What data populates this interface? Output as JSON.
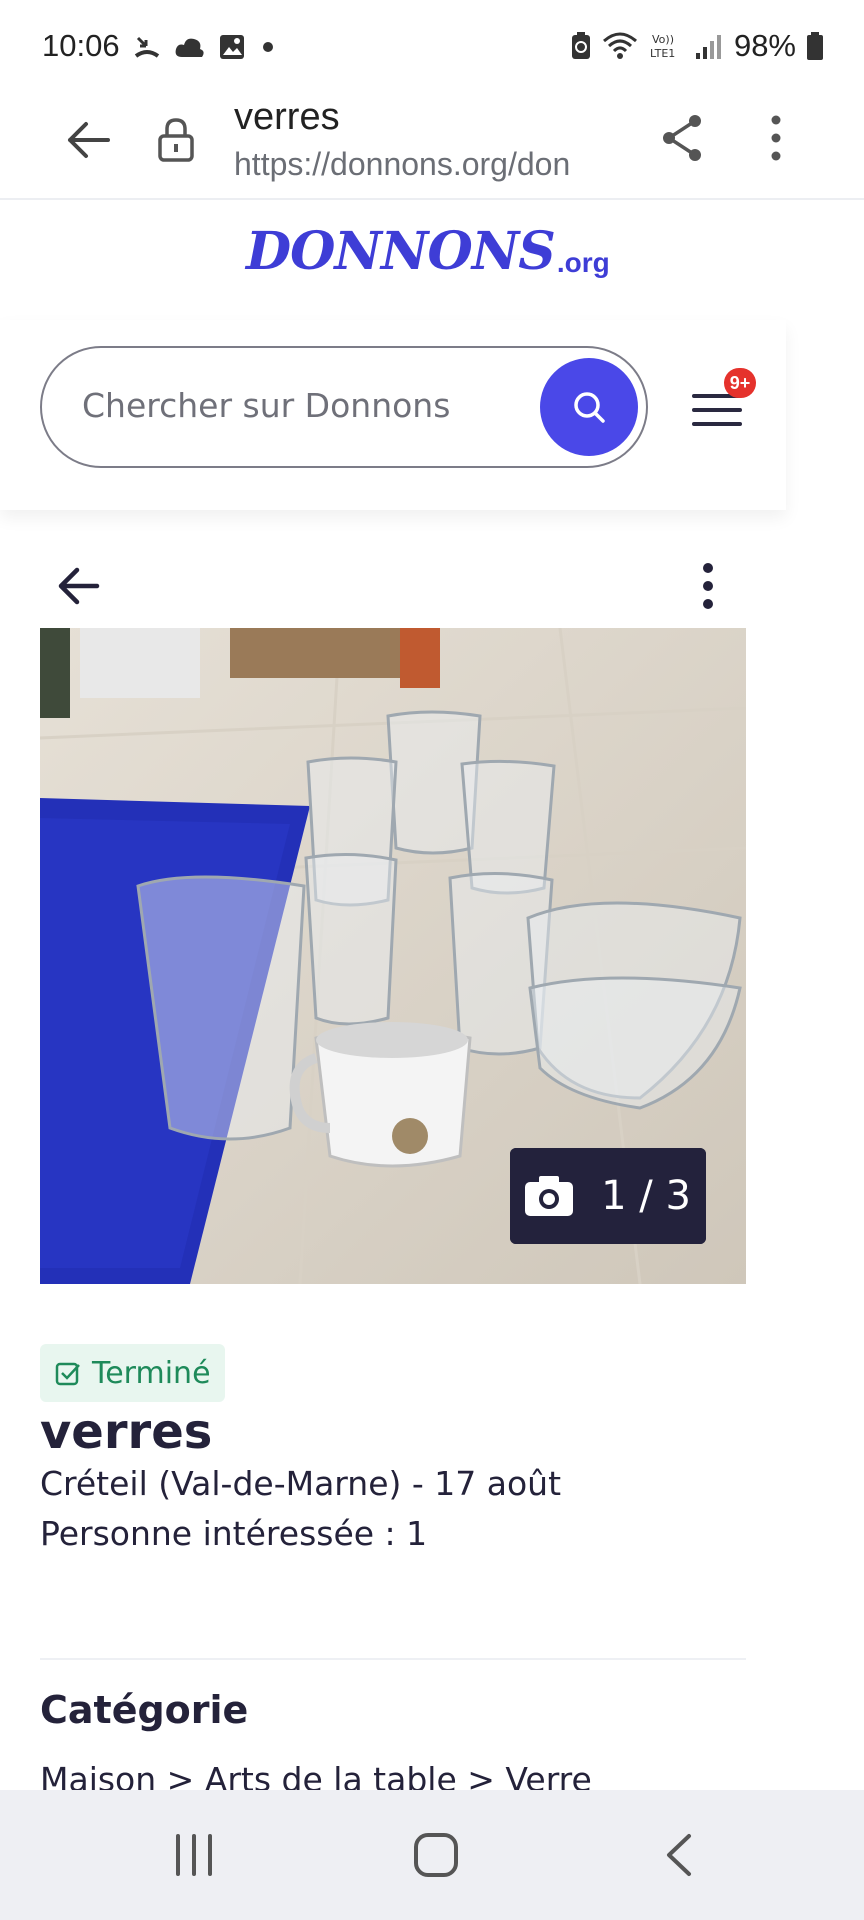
{
  "status_bar": {
    "time": "10:06",
    "battery": "98%",
    "icons": [
      "missed-call-icon",
      "cloud-icon",
      "gallery-icon",
      "dot-icon",
      "battery-saver-icon",
      "wifi-icon",
      "volte-icon",
      "signal-icon",
      "battery-icon"
    ]
  },
  "browser": {
    "title": "verres",
    "url": "https://donnons.org/don"
  },
  "site": {
    "logo_text": "DONNONS",
    "logo_suffix": ".org",
    "search_placeholder": "Chercher sur Donnons",
    "menu_badge": "9+",
    "brand_color": "#4a48e8"
  },
  "listing": {
    "photo_counter": "1 / 3",
    "status": "Terminé",
    "title": "verres",
    "meta": "Créteil (Val-de-Marne) - 17 août",
    "interested": "Personne intéressée : 1",
    "category_heading": "Catégorie",
    "category_path": "Maison > Arts de la table > Verre"
  }
}
